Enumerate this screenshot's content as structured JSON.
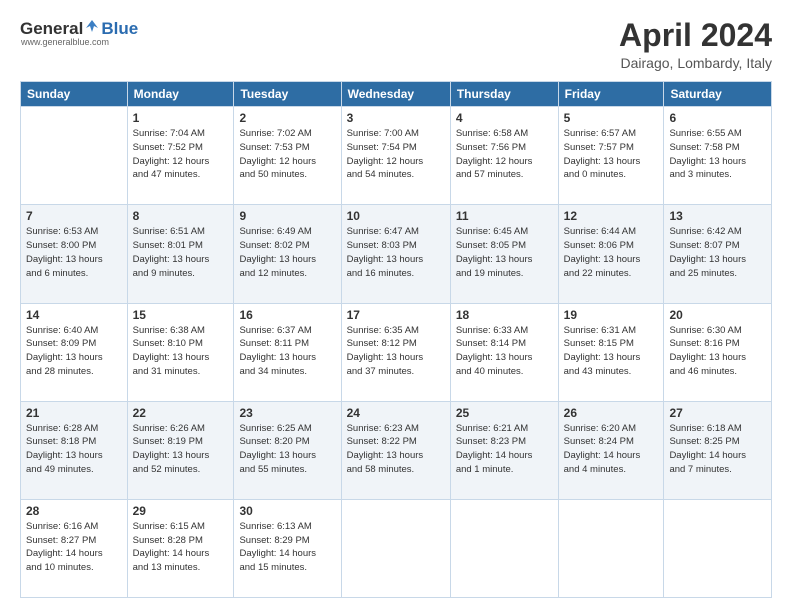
{
  "header": {
    "logo": {
      "general": "General",
      "blue": "Blue",
      "tagline": "www.generalblue.com"
    },
    "title": "April 2024",
    "location": "Dairago, Lombardy, Italy"
  },
  "weekdays": [
    "Sunday",
    "Monday",
    "Tuesday",
    "Wednesday",
    "Thursday",
    "Friday",
    "Saturday"
  ],
  "weeks": [
    [
      {
        "day": "",
        "info": ""
      },
      {
        "day": "1",
        "info": "Sunrise: 7:04 AM\nSunset: 7:52 PM\nDaylight: 12 hours\nand 47 minutes."
      },
      {
        "day": "2",
        "info": "Sunrise: 7:02 AM\nSunset: 7:53 PM\nDaylight: 12 hours\nand 50 minutes."
      },
      {
        "day": "3",
        "info": "Sunrise: 7:00 AM\nSunset: 7:54 PM\nDaylight: 12 hours\nand 54 minutes."
      },
      {
        "day": "4",
        "info": "Sunrise: 6:58 AM\nSunset: 7:56 PM\nDaylight: 12 hours\nand 57 minutes."
      },
      {
        "day": "5",
        "info": "Sunrise: 6:57 AM\nSunset: 7:57 PM\nDaylight: 13 hours\nand 0 minutes."
      },
      {
        "day": "6",
        "info": "Sunrise: 6:55 AM\nSunset: 7:58 PM\nDaylight: 13 hours\nand 3 minutes."
      }
    ],
    [
      {
        "day": "7",
        "info": "Sunrise: 6:53 AM\nSunset: 8:00 PM\nDaylight: 13 hours\nand 6 minutes."
      },
      {
        "day": "8",
        "info": "Sunrise: 6:51 AM\nSunset: 8:01 PM\nDaylight: 13 hours\nand 9 minutes."
      },
      {
        "day": "9",
        "info": "Sunrise: 6:49 AM\nSunset: 8:02 PM\nDaylight: 13 hours\nand 12 minutes."
      },
      {
        "day": "10",
        "info": "Sunrise: 6:47 AM\nSunset: 8:03 PM\nDaylight: 13 hours\nand 16 minutes."
      },
      {
        "day": "11",
        "info": "Sunrise: 6:45 AM\nSunset: 8:05 PM\nDaylight: 13 hours\nand 19 minutes."
      },
      {
        "day": "12",
        "info": "Sunrise: 6:44 AM\nSunset: 8:06 PM\nDaylight: 13 hours\nand 22 minutes."
      },
      {
        "day": "13",
        "info": "Sunrise: 6:42 AM\nSunset: 8:07 PM\nDaylight: 13 hours\nand 25 minutes."
      }
    ],
    [
      {
        "day": "14",
        "info": "Sunrise: 6:40 AM\nSunset: 8:09 PM\nDaylight: 13 hours\nand 28 minutes."
      },
      {
        "day": "15",
        "info": "Sunrise: 6:38 AM\nSunset: 8:10 PM\nDaylight: 13 hours\nand 31 minutes."
      },
      {
        "day": "16",
        "info": "Sunrise: 6:37 AM\nSunset: 8:11 PM\nDaylight: 13 hours\nand 34 minutes."
      },
      {
        "day": "17",
        "info": "Sunrise: 6:35 AM\nSunset: 8:12 PM\nDaylight: 13 hours\nand 37 minutes."
      },
      {
        "day": "18",
        "info": "Sunrise: 6:33 AM\nSunset: 8:14 PM\nDaylight: 13 hours\nand 40 minutes."
      },
      {
        "day": "19",
        "info": "Sunrise: 6:31 AM\nSunset: 8:15 PM\nDaylight: 13 hours\nand 43 minutes."
      },
      {
        "day": "20",
        "info": "Sunrise: 6:30 AM\nSunset: 8:16 PM\nDaylight: 13 hours\nand 46 minutes."
      }
    ],
    [
      {
        "day": "21",
        "info": "Sunrise: 6:28 AM\nSunset: 8:18 PM\nDaylight: 13 hours\nand 49 minutes."
      },
      {
        "day": "22",
        "info": "Sunrise: 6:26 AM\nSunset: 8:19 PM\nDaylight: 13 hours\nand 52 minutes."
      },
      {
        "day": "23",
        "info": "Sunrise: 6:25 AM\nSunset: 8:20 PM\nDaylight: 13 hours\nand 55 minutes."
      },
      {
        "day": "24",
        "info": "Sunrise: 6:23 AM\nSunset: 8:22 PM\nDaylight: 13 hours\nand 58 minutes."
      },
      {
        "day": "25",
        "info": "Sunrise: 6:21 AM\nSunset: 8:23 PM\nDaylight: 14 hours\nand 1 minute."
      },
      {
        "day": "26",
        "info": "Sunrise: 6:20 AM\nSunset: 8:24 PM\nDaylight: 14 hours\nand 4 minutes."
      },
      {
        "day": "27",
        "info": "Sunrise: 6:18 AM\nSunset: 8:25 PM\nDaylight: 14 hours\nand 7 minutes."
      }
    ],
    [
      {
        "day": "28",
        "info": "Sunrise: 6:16 AM\nSunset: 8:27 PM\nDaylight: 14 hours\nand 10 minutes."
      },
      {
        "day": "29",
        "info": "Sunrise: 6:15 AM\nSunset: 8:28 PM\nDaylight: 14 hours\nand 13 minutes."
      },
      {
        "day": "30",
        "info": "Sunrise: 6:13 AM\nSunset: 8:29 PM\nDaylight: 14 hours\nand 15 minutes."
      },
      {
        "day": "",
        "info": ""
      },
      {
        "day": "",
        "info": ""
      },
      {
        "day": "",
        "info": ""
      },
      {
        "day": "",
        "info": ""
      }
    ]
  ]
}
